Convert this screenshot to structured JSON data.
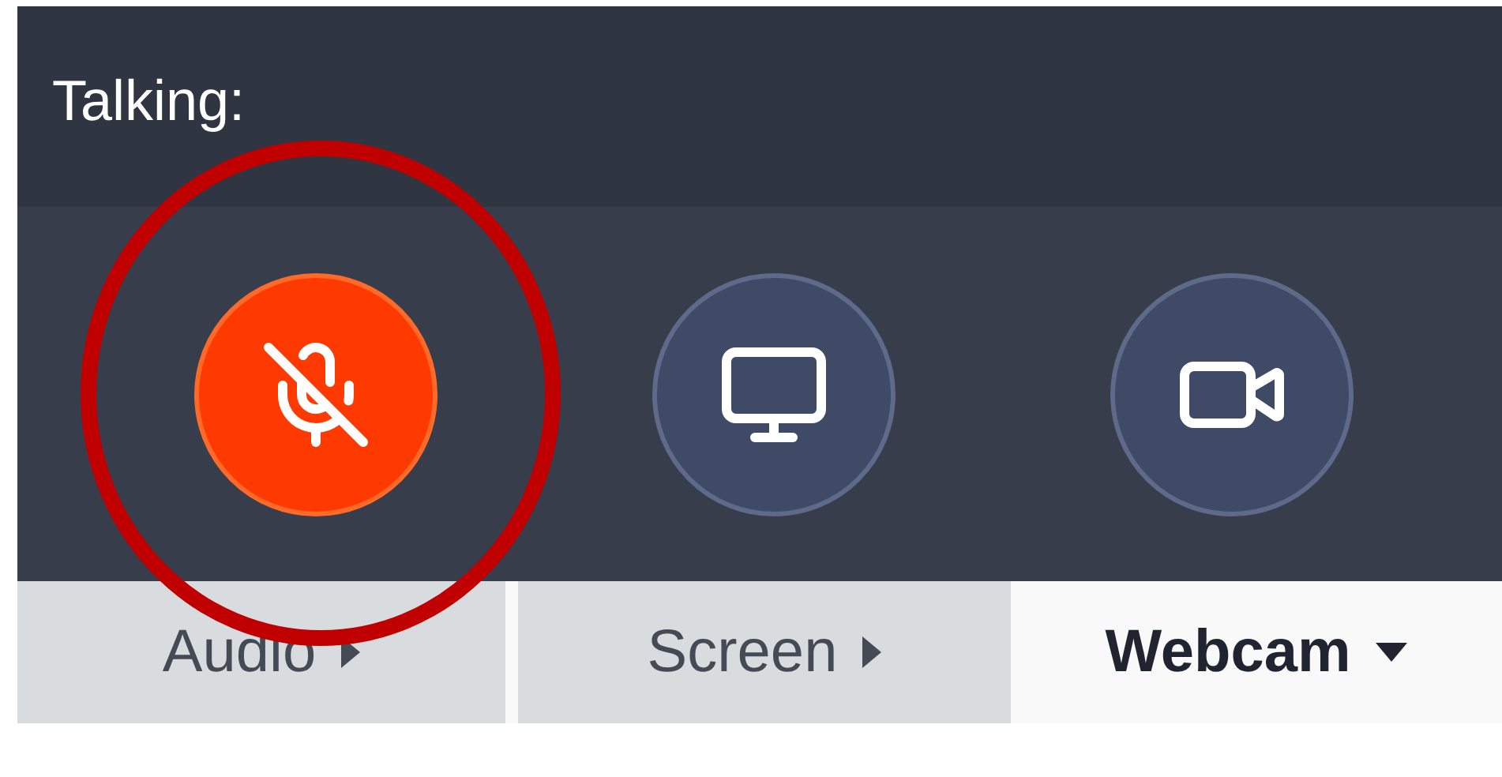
{
  "talking_label": "Talking:",
  "buttons": [
    {
      "kind": "mic",
      "active": true
    },
    {
      "kind": "screen",
      "active": false
    },
    {
      "kind": "webcam",
      "active": false
    }
  ],
  "tabs": [
    {
      "label": "Audio",
      "selected": false
    },
    {
      "label": "Screen",
      "selected": false
    },
    {
      "label": "Webcam",
      "selected": true
    }
  ]
}
